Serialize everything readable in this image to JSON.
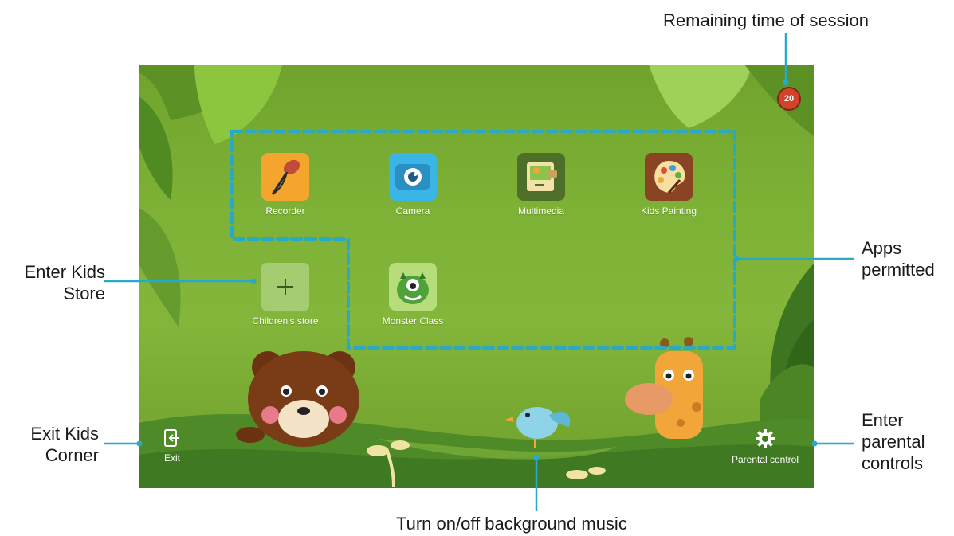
{
  "callouts": {
    "remaining_time": "Remaining time of session",
    "apps_permitted_line1": "Apps",
    "apps_permitted_line2": "permitted",
    "kids_store_line1": "Enter Kids",
    "kids_store_line2": "Store",
    "exit_line1": "Exit Kids",
    "exit_line2": "Corner",
    "parental_line1": "Enter",
    "parental_line2": "parental",
    "parental_line3": "controls",
    "music": "Turn on/off background music"
  },
  "timer": {
    "value": "20"
  },
  "apps": [
    {
      "label": "Recorder",
      "icon": "microphone-icon"
    },
    {
      "label": "Camera",
      "icon": "camera-icon"
    },
    {
      "label": "Multimedia",
      "icon": "photo-album-icon"
    },
    {
      "label": "Kids Painting",
      "icon": "palette-icon"
    },
    {
      "label": "Children's store",
      "icon": "plus-icon"
    },
    {
      "label": "Monster Class",
      "icon": "green-monster-icon"
    }
  ],
  "bottom_bar": {
    "exit_label": "Exit",
    "parental_label": "Parental control"
  },
  "colors": {
    "callout_line": "#29a9c9",
    "screen_green": "#7eb236",
    "hill_dark": "#3f7a22"
  }
}
